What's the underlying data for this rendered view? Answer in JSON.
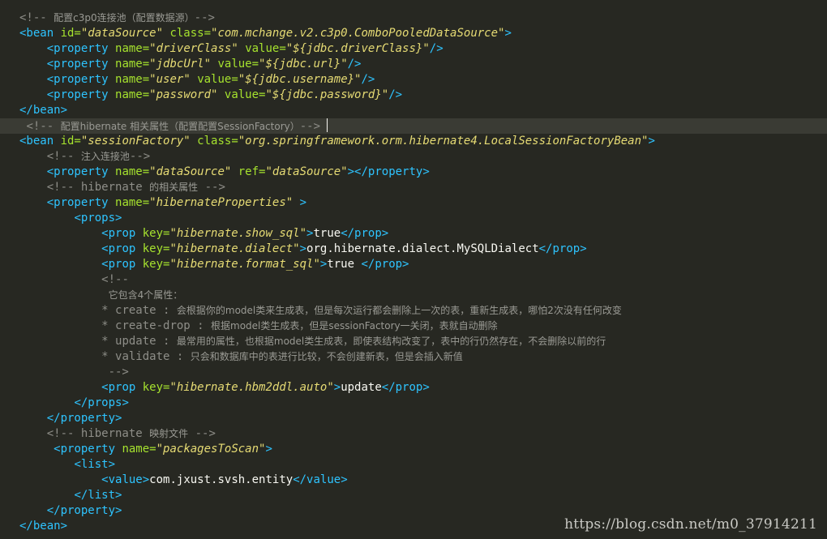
{
  "code_lines": [
    {
      "segments": [
        [
          "com",
          "<!-- "
        ],
        [
          "comcjk",
          "配置c3p0连接池（配置数据源）"
        ],
        [
          "com",
          "-->"
        ]
      ]
    },
    {
      "segments": [
        [
          "tag",
          "<bean "
        ],
        [
          "attr",
          "id="
        ],
        [
          "val",
          "\"dataSource\" "
        ],
        [
          "attr",
          "class="
        ],
        [
          "val",
          "\"com.mchange.v2.c3p0.ComboPooledDataSource\""
        ],
        [
          "tag",
          ">"
        ]
      ]
    },
    {
      "segments": [
        [
          "text",
          "    "
        ],
        [
          "tag",
          "<property "
        ],
        [
          "attr",
          "name="
        ],
        [
          "val",
          "\"driverClass\" "
        ],
        [
          "attr",
          "value="
        ],
        [
          "val",
          "\"${jdbc.driverClass}\""
        ],
        [
          "tag",
          "/>"
        ]
      ]
    },
    {
      "segments": [
        [
          "text",
          "    "
        ],
        [
          "tag",
          "<property "
        ],
        [
          "attr",
          "name="
        ],
        [
          "val",
          "\"jdbcUrl\" "
        ],
        [
          "attr",
          "value="
        ],
        [
          "val",
          "\"${jdbc.url}\""
        ],
        [
          "tag",
          "/>"
        ]
      ]
    },
    {
      "segments": [
        [
          "text",
          "    "
        ],
        [
          "tag",
          "<property "
        ],
        [
          "attr",
          "name="
        ],
        [
          "val",
          "\"user\" "
        ],
        [
          "attr",
          "value="
        ],
        [
          "val",
          "\"${jdbc.username}\""
        ],
        [
          "tag",
          "/>"
        ]
      ]
    },
    {
      "segments": [
        [
          "text",
          "    "
        ],
        [
          "tag",
          "<property "
        ],
        [
          "attr",
          "name="
        ],
        [
          "val",
          "\"password\" "
        ],
        [
          "attr",
          "value="
        ],
        [
          "val",
          "\"${jdbc.password}\""
        ],
        [
          "tag",
          "/>"
        ]
      ]
    },
    {
      "segments": [
        [
          "tag",
          "</bean>"
        ]
      ]
    },
    {
      "current": true,
      "segments": [
        [
          "text",
          " "
        ],
        [
          "com",
          "<!-- "
        ],
        [
          "comcjk",
          "配置hibernate 相关属性（配置配置SessionFactory）"
        ],
        [
          "com",
          "-->"
        ]
      ]
    },
    {
      "segments": [
        [
          "tag",
          "<bean "
        ],
        [
          "attr",
          "id="
        ],
        [
          "val",
          "\"sessionFactory\" "
        ],
        [
          "attr",
          "class="
        ],
        [
          "val",
          "\"org.springframework.orm.hibernate4.LocalSessionFactoryBean\""
        ],
        [
          "tag",
          ">"
        ]
      ]
    },
    {
      "segments": [
        [
          "text",
          "    "
        ],
        [
          "com",
          "<!-- "
        ],
        [
          "comcjk",
          "注入连接池"
        ],
        [
          "com",
          "-->"
        ]
      ]
    },
    {
      "segments": [
        [
          "text",
          "    "
        ],
        [
          "tag",
          "<property "
        ],
        [
          "attr",
          "name="
        ],
        [
          "val",
          "\"dataSource\" "
        ],
        [
          "attr",
          "ref="
        ],
        [
          "val",
          "\"dataSource\""
        ],
        [
          "tag",
          "></property>"
        ]
      ]
    },
    {
      "segments": [
        [
          "text",
          "    "
        ],
        [
          "com",
          "<!-- hibernate "
        ],
        [
          "comcjk",
          "的相关属性"
        ],
        [
          "com",
          " -->"
        ]
      ]
    },
    {
      "segments": [
        [
          "text",
          "    "
        ],
        [
          "tag",
          "<property "
        ],
        [
          "attr",
          "name="
        ],
        [
          "val",
          "\"hibernateProperties\" "
        ],
        [
          "tag",
          ">"
        ]
      ]
    },
    {
      "segments": [
        [
          "text",
          "        "
        ],
        [
          "tag",
          "<props>"
        ]
      ]
    },
    {
      "segments": [
        [
          "text",
          "            "
        ],
        [
          "tag",
          "<prop "
        ],
        [
          "attr",
          "key="
        ],
        [
          "val",
          "\"hibernate.show_sql\""
        ],
        [
          "tag",
          ">"
        ],
        [
          "text",
          "true"
        ],
        [
          "tag",
          "</prop>"
        ]
      ]
    },
    {
      "segments": [
        [
          "text",
          "            "
        ],
        [
          "tag",
          "<prop "
        ],
        [
          "attr",
          "key="
        ],
        [
          "val",
          "\"hibernate.dialect\""
        ],
        [
          "tag",
          ">"
        ],
        [
          "text",
          "org.hibernate.dialect.MySQLDialect"
        ],
        [
          "tag",
          "</prop>"
        ]
      ]
    },
    {
      "segments": [
        [
          "text",
          "            "
        ],
        [
          "tag",
          "<prop "
        ],
        [
          "attr",
          "key="
        ],
        [
          "val",
          "\"hibernate.format_sql\""
        ],
        [
          "tag",
          ">"
        ],
        [
          "text",
          "true "
        ],
        [
          "tag",
          "</prop>"
        ]
      ]
    },
    {
      "segments": [
        [
          "text",
          "            "
        ],
        [
          "com",
          "<!--"
        ]
      ]
    },
    {
      "segments": [
        [
          "text",
          "             "
        ],
        [
          "comcjk",
          "它包含4个属性："
        ]
      ]
    },
    {
      "segments": [
        [
          "text",
          "            "
        ],
        [
          "com",
          "* create : "
        ],
        [
          "comcjk",
          "会根据你的model类来生成表，但是每次运行都会删除上一次的表，重新生成表，哪怕2次没有任何改变"
        ]
      ]
    },
    {
      "segments": [
        [
          "text",
          "            "
        ],
        [
          "com",
          "* create-drop : "
        ],
        [
          "comcjk",
          "根据model类生成表，但是sessionFactory一关闭，表就自动删除"
        ]
      ]
    },
    {
      "segments": [
        [
          "text",
          "            "
        ],
        [
          "com",
          "* update : "
        ],
        [
          "comcjk",
          "最常用的属性，也根据model类生成表，即使表结构改变了，表中的行仍然存在，不会删除以前的行"
        ]
      ]
    },
    {
      "segments": [
        [
          "text",
          "            "
        ],
        [
          "com",
          "* validate : "
        ],
        [
          "comcjk",
          "只会和数据库中的表进行比较，不会创建新表，但是会插入新值"
        ]
      ]
    },
    {
      "segments": [
        [
          "text",
          "             "
        ],
        [
          "com",
          "-->"
        ]
      ]
    },
    {
      "segments": [
        [
          "text",
          "            "
        ],
        [
          "tag",
          "<prop "
        ],
        [
          "attr",
          "key="
        ],
        [
          "val",
          "\"hibernate.hbm2ddl.auto\""
        ],
        [
          "tag",
          ">"
        ],
        [
          "text",
          "update"
        ],
        [
          "tag",
          "</prop>"
        ]
      ]
    },
    {
      "segments": [
        [
          "text",
          "        "
        ],
        [
          "tag",
          "</props>"
        ]
      ]
    },
    {
      "segments": [
        [
          "text",
          "    "
        ],
        [
          "tag",
          "</property>"
        ]
      ]
    },
    {
      "segments": [
        [
          "text",
          "    "
        ],
        [
          "com",
          "<!-- hibernate "
        ],
        [
          "comcjk",
          "映射文件"
        ],
        [
          "com",
          " -->"
        ]
      ]
    },
    {
      "segments": [
        [
          "text",
          "     "
        ],
        [
          "tag",
          "<property "
        ],
        [
          "attr",
          "name="
        ],
        [
          "val",
          "\"packagesToScan\""
        ],
        [
          "tag",
          ">"
        ]
      ]
    },
    {
      "segments": [
        [
          "text",
          "        "
        ],
        [
          "tag",
          "<list>"
        ]
      ]
    },
    {
      "segments": [
        [
          "text",
          "            "
        ],
        [
          "tag",
          "<value>"
        ],
        [
          "text",
          "com.jxust.svsh.entity"
        ],
        [
          "tag",
          "</value>"
        ]
      ]
    },
    {
      "segments": [
        [
          "text",
          "        "
        ],
        [
          "tag",
          "</list>"
        ]
      ]
    },
    {
      "segments": [
        [
          "text",
          "    "
        ],
        [
          "tag",
          "</property>"
        ]
      ]
    },
    {
      "segments": [
        [
          "tag",
          "</bean>"
        ]
      ]
    }
  ],
  "watermark": "https://blog.csdn.net/m0_37914211",
  "colors": {
    "background": "#272822",
    "current_line": "#3a3b34",
    "tag": "#2ec4ff",
    "attribute": "#a6e22e",
    "value": "#e6db74",
    "text": "#f8f8f2",
    "comment": "#8e8e88"
  }
}
